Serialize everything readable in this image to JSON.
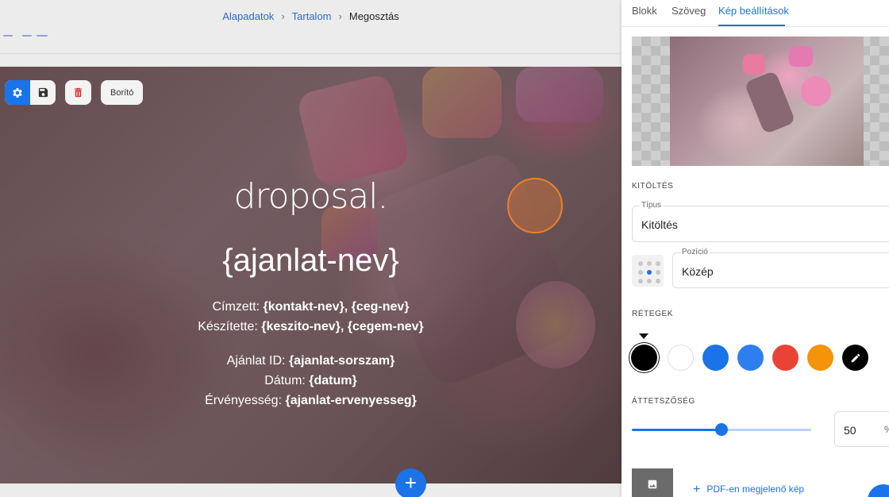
{
  "breadcrumb": {
    "items": [
      "Alapadatok",
      "Tartalom"
    ],
    "current": "Megosztás",
    "separator": "›"
  },
  "toolbar": {
    "cover_label": "Borító"
  },
  "slide": {
    "brand": "droposal.",
    "title": "{ajanlat-nev}",
    "lines": [
      {
        "label": "Címzett: ",
        "value": "{kontakt-nev}, {ceg-nev}"
      },
      {
        "label": "Készítette: ",
        "value": "{keszito-nev}, {cegem-nev}"
      },
      {
        "label": "Ajánlat ID: ",
        "value": "{ajanlat-sorszam}"
      },
      {
        "label": "Dátum: ",
        "value": "{datum}"
      },
      {
        "label": "Érvényesség: ",
        "value": "{ajanlat-ervenyesseg}"
      }
    ],
    "add_label": "+"
  },
  "panel": {
    "tabs": [
      "Blokk",
      "Szöveg",
      "Kép beállítások"
    ],
    "active_tab": "Kép beállítások",
    "fill_section": "KITÖLTÉS",
    "type_field": {
      "label": "Típus",
      "value": "Kitöltés"
    },
    "position_field": {
      "label": "Pozíció",
      "value": "Közép"
    },
    "layers_section": "RÉTEGEK",
    "swatches": [
      "#000000",
      "#ffffff",
      "#1a73e8",
      "#2d7ff0",
      "#ea4335",
      "#f5930a"
    ],
    "opacity_section": "ÁTTETSZŐSÉG",
    "opacity_value": "50",
    "opacity_fraction": 0.5,
    "opacity_unit": "%",
    "pdf_link": "PDF-en megjelenő kép"
  }
}
